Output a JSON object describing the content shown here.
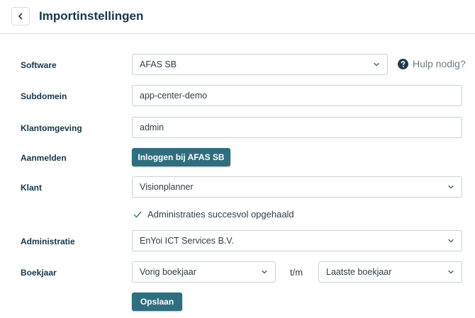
{
  "header": {
    "title": "Importinstellingen"
  },
  "form": {
    "software": {
      "label": "Software",
      "value": "AFAS SB"
    },
    "help": {
      "text": "Hulp nodig?"
    },
    "subdomain": {
      "label": "Subdomein",
      "value": "app-center-demo"
    },
    "environment": {
      "label": "Klantomgeving",
      "value": "admin"
    },
    "login": {
      "label": "Aanmelden",
      "button": "Inloggen bij AFAS SB"
    },
    "client": {
      "label": "Klant",
      "value": "Visionplanner"
    },
    "success_message": "Administraties succesvol opgehaald",
    "administration": {
      "label": "Administratie",
      "value": "EnYoi ICT Services B.V."
    },
    "fiscal_year": {
      "label": "Boekjaar",
      "from": "Vorig boekjaar",
      "separator": "t/m",
      "to": "Laatste boekjaar"
    },
    "save_button": "Opslaan"
  },
  "colors": {
    "primary": "#2e6e7e",
    "heading": "#14384b",
    "success": "#3c8c4a",
    "border": "#c9d0d4"
  },
  "icons": {
    "back": "chevron-left-icon",
    "dropdown": "chevron-down-icon",
    "help": "question-circle-icon",
    "success": "check-icon"
  }
}
